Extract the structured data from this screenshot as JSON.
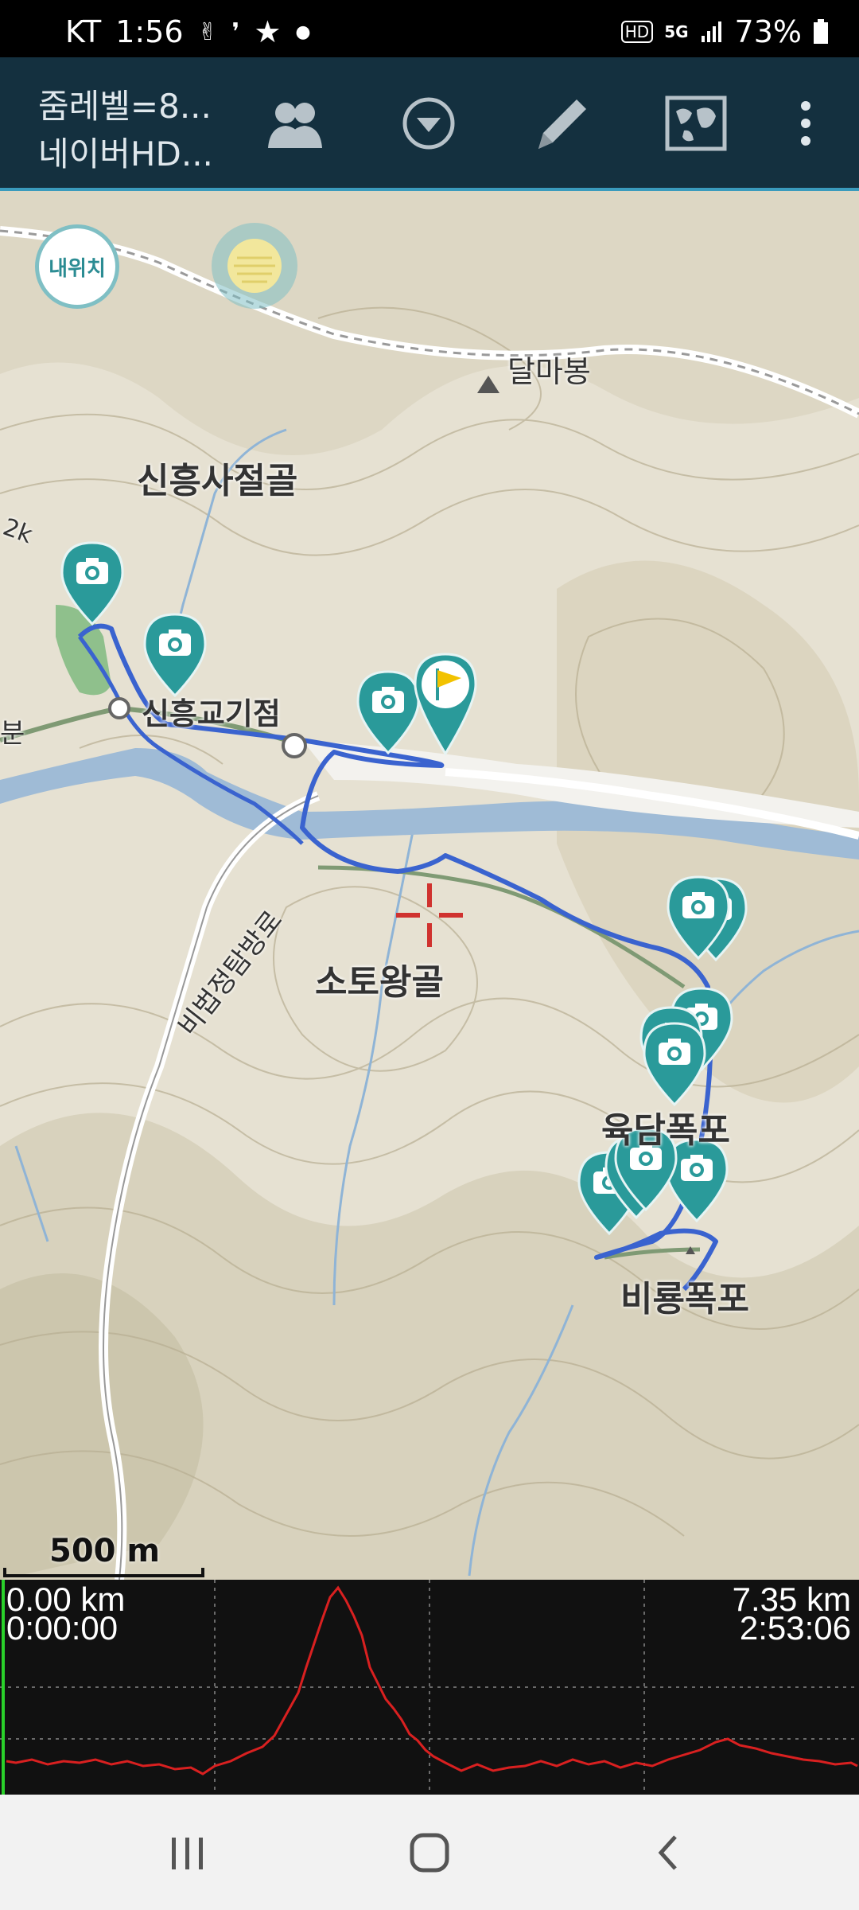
{
  "status_bar": {
    "carrier": "KT",
    "time": "1:56",
    "network": "5G",
    "battery": "73%"
  },
  "app_bar": {
    "line1": "줌레벨=8...",
    "line2": "네이버HD...",
    "icons": [
      "people-icon",
      "dropdown-icon",
      "pencil-icon",
      "map-icon",
      "more-icon"
    ]
  },
  "map": {
    "my_location_button": "내위치",
    "labels": {
      "peak": "달마봉",
      "valley1": "신흥사절골",
      "junction": "신흥교기점",
      "valley2": "소토왕골",
      "road": "비법정탐방로",
      "falls1": "육담폭포",
      "falls2": "비룡폭포",
      "left_edge": "분",
      "track_mark": "2k"
    },
    "scale": "500 m"
  },
  "elevation_chart": {
    "start_distance": "0.00 km",
    "start_time": "0:00:00",
    "end_distance": "7.35 km",
    "end_time": "2:53:06",
    "line_color": "#d92020"
  },
  "nav_bar": {
    "buttons": [
      "recents-icon",
      "home-icon",
      "back-icon"
    ]
  }
}
